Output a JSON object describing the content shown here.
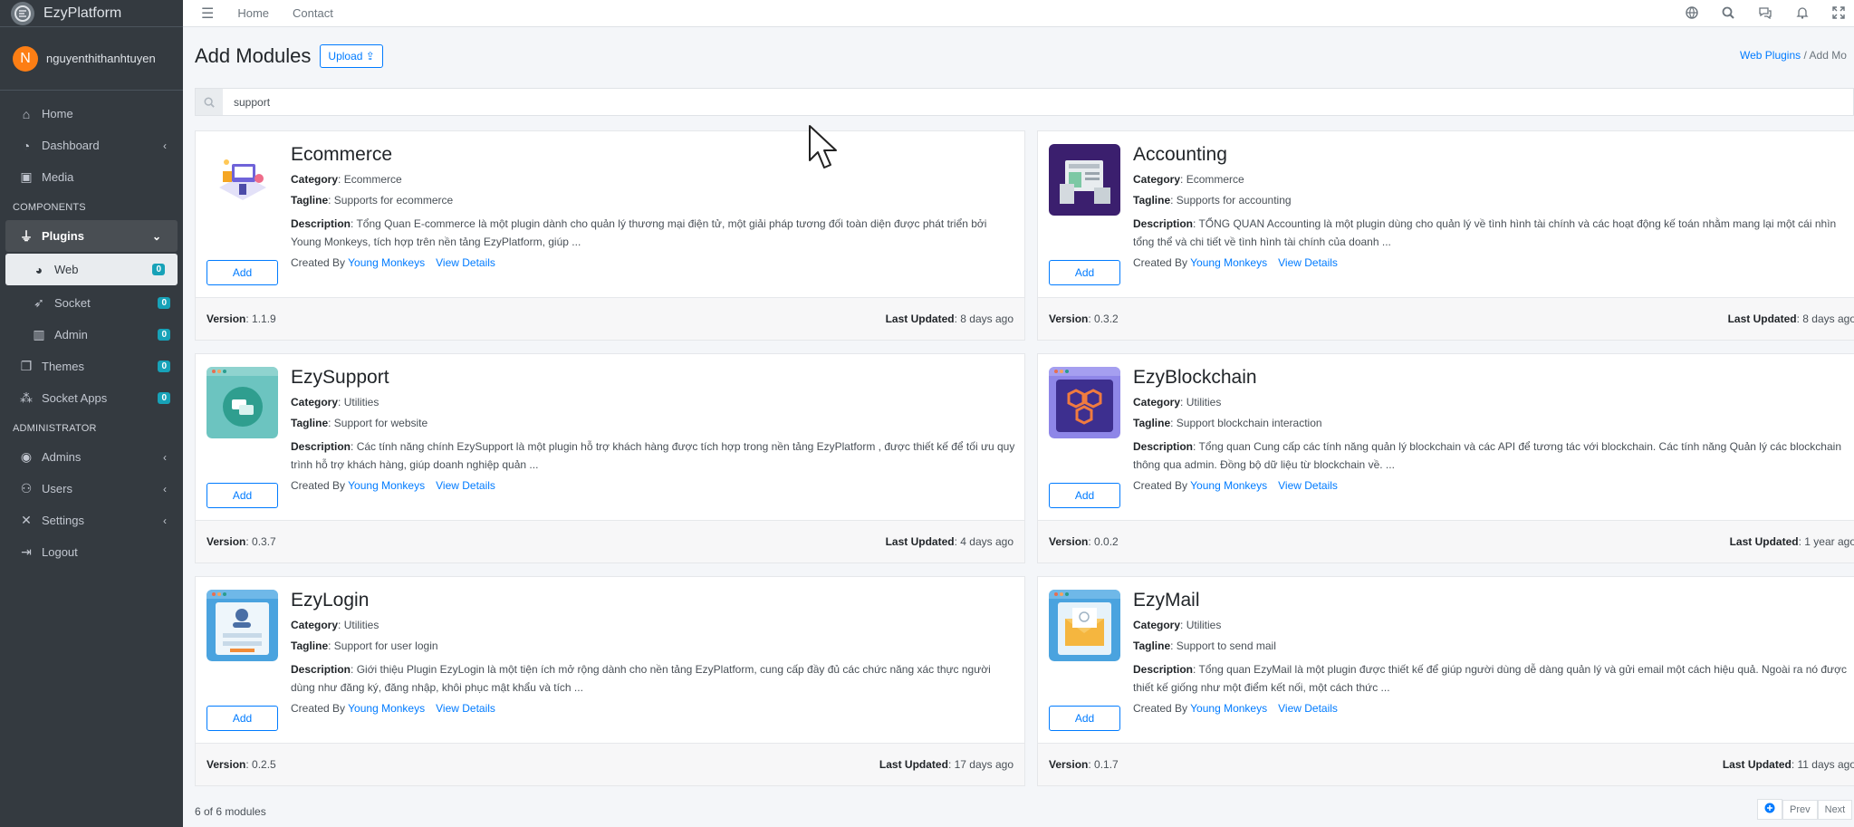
{
  "brand": {
    "name": "EzyPlatform",
    "logo_icon": "ezyplatform-logo-icon"
  },
  "user": {
    "initial": "N",
    "name": "nguyenthithanhtuyen",
    "avatar_color": "#fd7e14"
  },
  "sidebar": {
    "items": [
      {
        "label": "Home",
        "icon": "home-icon"
      },
      {
        "label": "Dashboard",
        "icon": "dashboard-icon"
      },
      {
        "label": "Media",
        "icon": "image-icon"
      }
    ],
    "components_header": "COMPONENTS",
    "plugins": {
      "label": "Plugins",
      "icon": "plug-icon"
    },
    "plugin_children": [
      {
        "label": "Web",
        "badge": "0"
      },
      {
        "label": "Socket",
        "badge": "0"
      },
      {
        "label": "Admin",
        "badge": "0"
      }
    ],
    "themes": {
      "label": "Themes",
      "badge": "0"
    },
    "socket_apps": {
      "label": "Socket Apps",
      "badge": "0"
    },
    "administrator_header": "ADMINISTRATOR",
    "admin_items": [
      {
        "label": "Admins"
      },
      {
        "label": "Users"
      },
      {
        "label": "Settings"
      },
      {
        "label": "Logout"
      }
    ]
  },
  "topbar": {
    "home": "Home",
    "contact": "Contact"
  },
  "page": {
    "title": "Add Modules",
    "upload_label": "Upload",
    "breadcrumb_link": "Web Plugins",
    "breadcrumb_current": "Add Mo",
    "search_value": "support",
    "count_text": "6 of 6 modules",
    "prev": "Prev",
    "next": "Next"
  },
  "labels": {
    "category": "Category",
    "tagline": "Tagline",
    "description": "Description",
    "created_by": "Created By",
    "view_details": "View Details",
    "add": "Add",
    "version": "Version",
    "last_updated": "Last Updated"
  },
  "modules": [
    {
      "name": "Ecommerce",
      "category": "Ecommerce",
      "tagline": "Supports for ecommerce",
      "description": "Tổng Quan E-commerce là một plugin dành cho quản lý thương mại điện tử, một giải pháp tương đối toàn diện được phát triển bởi Young Monkeys, tích hợp trên nền tảng EzyPlatform, giúp ...",
      "author": "Young Monkeys",
      "version": "1.1.9",
      "last_updated": "8 days ago",
      "thumb_color": "#ffffff"
    },
    {
      "name": "Accounting",
      "category": "Ecommerce",
      "tagline": "Supports for accounting",
      "description": "TỔNG QUAN Accounting là một plugin dùng cho quản lý về tình hình tài chính và các hoạt động kế toán nhằm mang lại một cái nhìn tổng thể và chi tiết về tình hình tài chính của doanh ...",
      "author": "Young Monkeys",
      "version": "0.3.2",
      "last_updated": "8 days ago",
      "thumb_color": "#3b1f6e"
    },
    {
      "name": "EzySupport",
      "category": "Utilities",
      "tagline": "Support for website",
      "description": "Các tính năng chính EzySupport là một plugin hỗ trợ khách hàng được tích hợp trong nền tảng EzyPlatform , được thiết kế để tối ưu quy trình hỗ trợ khách hàng, giúp doanh nghiệp quản ...",
      "author": "Young Monkeys",
      "version": "0.3.7",
      "last_updated": "4 days ago",
      "thumb_color": "#6cc4c0"
    },
    {
      "name": "EzyBlockchain",
      "category": "Utilities",
      "tagline": "Support blockchain interaction",
      "description": "Tổng quan Cung cấp các tính năng quản lý blockchain và các API để tương tác với blockchain. Các tính năng Quản lý các blockchain thông qua admin. Đồng bộ dữ liệu từ blockchain về. ...",
      "author": "Young Monkeys",
      "version": "0.0.2",
      "last_updated": "1 year ago",
      "thumb_color": "#3d2f8f"
    },
    {
      "name": "EzyLogin",
      "category": "Utilities",
      "tagline": "Support for user login",
      "description": "Giới thiệu Plugin EzyLogin là một tiện ích mở rộng dành cho nền tảng EzyPlatform, cung cấp đầy đủ các chức năng xác thực người dùng như đăng ký, đăng nhập, khôi phục mật khẩu và tích ...",
      "author": "Young Monkeys",
      "version": "0.2.5",
      "last_updated": "17 days ago",
      "thumb_color": "#4aa3df"
    },
    {
      "name": "EzyMail",
      "category": "Utilities",
      "tagline": "Support to send mail",
      "description": "Tổng quan EzyMail là một plugin được thiết kế để giúp người dùng dễ dàng quản lý và gửi email một cách hiệu quả. Ngoài ra nó được thiết kế giống như một điểm kết nối, một cách thức ...",
      "author": "Young Monkeys",
      "version": "0.1.7",
      "last_updated": "11 days ago",
      "thumb_color": "#4aa3df"
    }
  ]
}
